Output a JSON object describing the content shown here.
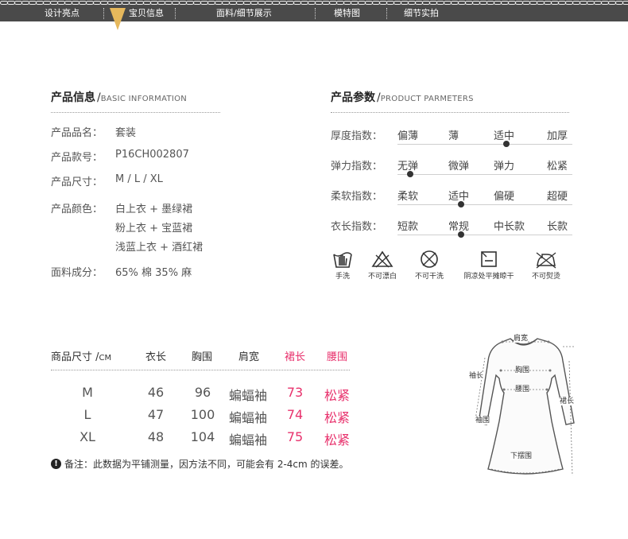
{
  "nav": {
    "items": [
      "设计亮点",
      "宝贝信息",
      "面料/细节展示",
      "模特图",
      "细节实拍"
    ],
    "active": "宝贝信息",
    "accent": "#e6b85c"
  },
  "product_info": {
    "title": "产品信息",
    "title_en": "BASIC INFORMATION",
    "rows": [
      {
        "label": "产品品名：",
        "value": "套装"
      },
      {
        "label": "产品款号：",
        "value": "P16CH002807"
      },
      {
        "label": "产品尺寸：",
        "value": "M / L / XL"
      },
      {
        "label": "产品颜色：",
        "value": "白上衣 + 墨绿裙"
      },
      {
        "label": "",
        "value": "粉上衣 + 宝蓝裙"
      },
      {
        "label": "",
        "value": "浅蓝上衣 + 酒红裙"
      },
      {
        "label": "面料成分：",
        "value": "65% 棉 35% 麻"
      }
    ]
  },
  "product_params": {
    "title": "产品参数",
    "title_en": "PRODUCT PARMETERS",
    "rows": [
      {
        "label": "厚度指数：",
        "options": [
          "偏薄",
          "薄",
          "适中",
          "加厚"
        ],
        "selected": 2
      },
      {
        "label": "弹力指数：",
        "options": [
          "无弹",
          "微弹",
          "弹力",
          "松紧"
        ],
        "selected": 0
      },
      {
        "label": "柔软指数：",
        "options": [
          "柔软",
          "适中",
          "偏硬",
          "超硬"
        ],
        "selected": 1
      },
      {
        "label": "衣长指数：",
        "options": [
          "短款",
          "常规",
          "中长款",
          "长款"
        ],
        "selected": 1
      }
    ],
    "care": [
      {
        "icon": "hand-wash-icon",
        "label": "手洗"
      },
      {
        "icon": "no-bleach-icon",
        "label": "不可漂白"
      },
      {
        "icon": "no-dry-clean-icon",
        "label": "不可干洗"
      },
      {
        "icon": "dry-flat-shade-icon",
        "label": "阴凉处平摊晾干"
      },
      {
        "icon": "no-iron-icon",
        "label": "不可熨烫"
      }
    ]
  },
  "size_table": {
    "header": {
      "title": "商品尺寸 /",
      "unit": "CM",
      "cols": [
        "衣长",
        "胸围",
        "肩宽",
        "裙长",
        "腰围"
      ]
    },
    "rows": [
      {
        "size": "M",
        "cells": [
          "46",
          "96",
          "蝙蝠袖",
          "73",
          "松紧"
        ]
      },
      {
        "size": "L",
        "cells": [
          "47",
          "100",
          "蝙蝠袖",
          "74",
          "松紧"
        ]
      },
      {
        "size": "XL",
        "cells": [
          "48",
          "104",
          "蝙蝠袖",
          "75",
          "松紧"
        ]
      }
    ],
    "highlight_color": "#e8316c",
    "note": "备注：此数据为平铺测量，因方法不同，可能会有 2-4cm 的误差。"
  },
  "diagram": {
    "labels": {
      "shoulder": "肩宽",
      "chest": "胸围",
      "sleeve": "袖长",
      "waist": "腰围",
      "cuff": "袖围",
      "skirt": "裙长",
      "hem": "下摆围"
    }
  }
}
